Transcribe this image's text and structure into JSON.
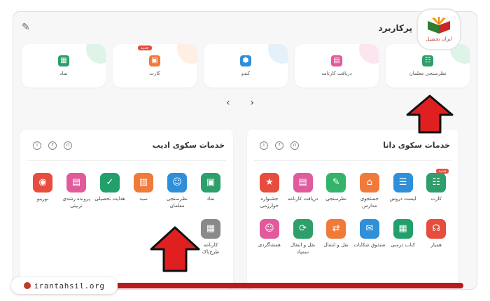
{
  "topbar": {
    "title": "پرکاربرد"
  },
  "logo": {
    "text": "ایران تحصیل"
  },
  "cards": [
    {
      "label": "نظرسنجی معلمان",
      "color": "#2e9e6b",
      "blob": "#b7e4cf",
      "icon": "survey-icon"
    },
    {
      "label": "دریافت کارنامه",
      "color": "#e05a9c",
      "blob": "#f7c6dc",
      "icon": "report-card-icon"
    },
    {
      "label": "کندو",
      "color": "#2f8fd8",
      "blob": "#c4def5",
      "icon": "hive-icon"
    },
    {
      "label": "کارت",
      "color": "#f07a3a",
      "blob": "#fcd9c2",
      "icon": "card-icon",
      "badge": "جدید"
    },
    {
      "label": "نماد",
      "color": "#2e9e6b",
      "blob": "#b7e4cf",
      "icon": "symbol-icon"
    }
  ],
  "pager": {
    "prev": "‹",
    "next": "›"
  },
  "panel_right": {
    "title": "خدمات سکوی دانا",
    "tiles": [
      {
        "label": "کارت",
        "color": "#2e9e6b",
        "glyph": "☷",
        "badge": "جدید"
      },
      {
        "label": "لیست دروس",
        "color": "#2f8fd8",
        "glyph": "☰"
      },
      {
        "label": "جستجوی مدارس",
        "color": "#f07a3a",
        "glyph": "⌂"
      },
      {
        "label": "نظرسنجی",
        "color": "#34b36b",
        "glyph": "✎"
      },
      {
        "label": "دریافت کارنامه",
        "color": "#e05a9c",
        "glyph": "▤"
      },
      {
        "label": "جشنواره خوارزمی",
        "color": "#e74c3c",
        "glyph": "★"
      },
      {
        "label": "همیار",
        "color": "#e74c3c",
        "glyph": "☊"
      },
      {
        "label": "کتاب درسی",
        "color": "#22a06b",
        "glyph": "▦"
      },
      {
        "label": "صندوق شکایات",
        "color": "#2f8fd8",
        "glyph": "✉"
      },
      {
        "label": "نقل و انتقال",
        "color": "#f07a3a",
        "glyph": "⇄"
      },
      {
        "label": "نقل و انتقال سمپاد",
        "color": "#2e9e6b",
        "glyph": "⟳"
      },
      {
        "label": "همشاگردی",
        "color": "#e05a9c",
        "glyph": "☺"
      }
    ]
  },
  "panel_left": {
    "title": "خدمات سکوی ادیب",
    "tiles": [
      {
        "label": "نماد",
        "color": "#2e9e6b",
        "glyph": "▣"
      },
      {
        "label": "نظرسنجی معلمان",
        "color": "#2f8fd8",
        "glyph": "☺"
      },
      {
        "label": "سبد",
        "color": "#f07a3a",
        "glyph": "▥"
      },
      {
        "label": "هدایت تحصیلی",
        "color": "#22a06b",
        "glyph": "✓"
      },
      {
        "label": "پرونده رشدی تربیتی",
        "color": "#e05a9c",
        "glyph": "▤"
      },
      {
        "label": "نورینو",
        "color": "#e74c3c",
        "glyph": "◉"
      },
      {
        "label": "کارنامه طرح‌پاک",
        "color": "#8a8a8a",
        "glyph": "▦"
      }
    ]
  },
  "footer": {
    "site": "irantahsil.org"
  },
  "colors": {
    "arrow": "#e02020",
    "bar": "#b71c1c"
  }
}
